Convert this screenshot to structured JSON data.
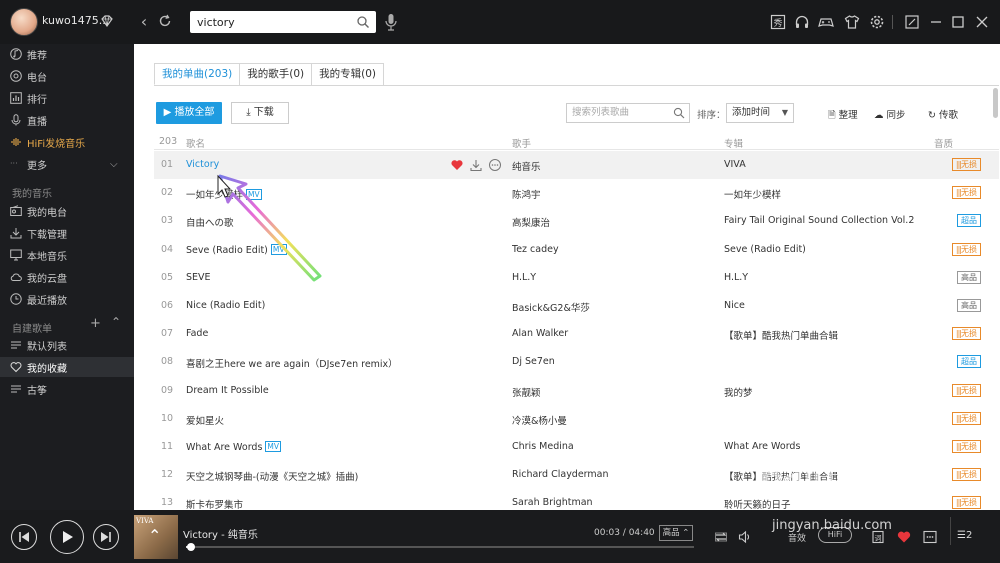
{
  "user": {
    "name": "kuwo1475...",
    "avatar_icon": "avatar",
    "vip_icon": "diamond-icon"
  },
  "search": {
    "value": "victory",
    "placeholder": ""
  },
  "sidebar": {
    "items": [
      {
        "label": "推荐",
        "icon": "music-note-icon"
      },
      {
        "label": "电台",
        "icon": "radio-icon"
      },
      {
        "label": "排行",
        "icon": "chart-icon"
      },
      {
        "label": "直播",
        "icon": "mic-icon"
      },
      {
        "label": "HiFi发烧音乐",
        "icon": "hifi-icon"
      },
      {
        "label": "更多",
        "icon": "more-icon"
      }
    ],
    "my_music_heading": "我的音乐",
    "my_music": [
      {
        "label": "我的电台",
        "icon": "radio-box-icon"
      },
      {
        "label": "下载管理",
        "icon": "download-icon"
      },
      {
        "label": "本地音乐",
        "icon": "computer-icon"
      },
      {
        "label": "我的云盘",
        "icon": "cloud-icon"
      },
      {
        "label": "最近播放",
        "icon": "clock-icon"
      }
    ],
    "playlists_heading": "自建歌单",
    "playlists": [
      {
        "label": "默认列表",
        "icon": "list-icon"
      },
      {
        "label": "我的收藏",
        "icon": "heart-icon"
      },
      {
        "label": "古筝",
        "icon": "list-icon"
      }
    ]
  },
  "tabs": [
    {
      "label": "我的单曲(203)",
      "active": true
    },
    {
      "label": "我的歌手(0)",
      "active": false
    },
    {
      "label": "我的专辑(0)",
      "active": false
    }
  ],
  "toolbar": {
    "play_all": "播放全部",
    "download": "下载",
    "list_search_placeholder": "搜索列表歌曲",
    "sort_label": "排序：",
    "sort_value": "添加时间",
    "organize": "整理",
    "sync": "同步",
    "upload": "传歌"
  },
  "table": {
    "count": "203",
    "headers": {
      "title": "歌名",
      "artist": "歌手",
      "album": "专辑",
      "quality": "音质"
    },
    "rows": [
      {
        "num": "01",
        "title": "Victory",
        "mv": false,
        "artist": "纯音乐",
        "album": "VIVA",
        "quality": "无损",
        "qtype": "lossless"
      },
      {
        "num": "02",
        "title": "一如年少模样",
        "mv": true,
        "artist": "陈鸿宇",
        "album": "一如年少模样",
        "quality": "无损",
        "qtype": "lossless"
      },
      {
        "num": "03",
        "title": "自由への歌",
        "mv": false,
        "artist": "高梨康治",
        "album": "Fairy Tail Original Sound Collection Vol.2",
        "quality": "超品",
        "qtype": "super"
      },
      {
        "num": "04",
        "title": "Seve (Radio Edit)",
        "mv": true,
        "artist": "Tez cadey",
        "album": "Seve (Radio Edit)",
        "quality": "无损",
        "qtype": "lossless"
      },
      {
        "num": "05",
        "title": "SEVE",
        "mv": false,
        "artist": "H.L.Y",
        "album": "H.L.Y",
        "quality": "高品",
        "qtype": "high"
      },
      {
        "num": "06",
        "title": "Nice (Radio Edit)",
        "mv": false,
        "artist": "Basick&G2&华莎",
        "album": "Nice",
        "quality": "高品",
        "qtype": "high"
      },
      {
        "num": "07",
        "title": "Fade",
        "mv": false,
        "artist": "Alan Walker",
        "album": "【歌单】酷我热门单曲合辑",
        "quality": "无损",
        "qtype": "lossless"
      },
      {
        "num": "08",
        "title": "喜剧之王here we are again（DJse7en remix）",
        "mv": false,
        "artist": "Dj Se7en",
        "album": "",
        "quality": "超品",
        "qtype": "super"
      },
      {
        "num": "09",
        "title": "Dream It Possible",
        "mv": false,
        "artist": "张靓颖",
        "album": "我的梦",
        "quality": "无损",
        "qtype": "lossless"
      },
      {
        "num": "10",
        "title": "爱如星火",
        "mv": false,
        "artist": "冷漠&杨小曼",
        "album": "",
        "quality": "无损",
        "qtype": "lossless"
      },
      {
        "num": "11",
        "title": "What Are Words",
        "mv": true,
        "artist": "Chris Medina",
        "album": "What Are Words",
        "quality": "无损",
        "qtype": "lossless"
      },
      {
        "num": "12",
        "title": "天空之城钢琴曲-(动漫《天空之城》插曲)",
        "mv": false,
        "artist": "Richard Clayderman",
        "album": "【歌单】酷我热门单曲合辑",
        "quality": "无损",
        "qtype": "lossless"
      },
      {
        "num": "13",
        "title": "斯卡布罗集市",
        "mv": false,
        "artist": "Sarah Brightman",
        "album": "聆听天籁的日子",
        "quality": "无损",
        "qtype": "lossless"
      }
    ]
  },
  "player": {
    "now_playing": "Victory - 纯音乐",
    "cover_text": "VIVA",
    "current_time": "00:03",
    "total_time": "04:40",
    "time_sep": " / ",
    "quality": "高品",
    "progress": 0.01,
    "sound_label": "音效",
    "hifi_label": "HiFi",
    "playlist_count": "2"
  },
  "watermark": {
    "text": "Baidu经验",
    "url": "jingyan.baidu.com"
  },
  "colors": {
    "accent": "#1e9be0",
    "lossless": "#e88a2a",
    "heart": "#e8363c"
  }
}
